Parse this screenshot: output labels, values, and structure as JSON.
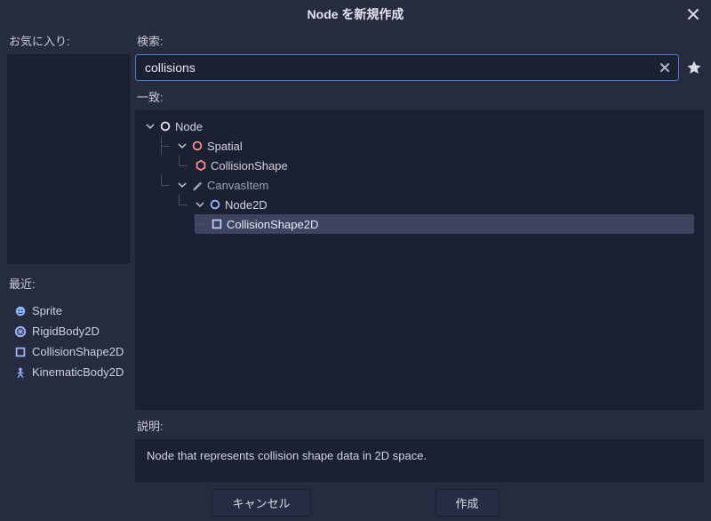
{
  "dialog": {
    "title": "Node を新規作成"
  },
  "left": {
    "favorites_label": "お気に入り:",
    "recent_label": "最近:",
    "recent": [
      {
        "label": "Sprite",
        "icon": "sprite"
      },
      {
        "label": "RigidBody2D",
        "icon": "rigid"
      },
      {
        "label": "CollisionShape2D",
        "icon": "collshape2d"
      },
      {
        "label": "KinematicBody2D",
        "icon": "kinematic"
      }
    ]
  },
  "right": {
    "search_label": "検索:",
    "search_value": "collisions",
    "matches_label": "一致:",
    "description_label": "説明:",
    "description_text": "Node that represents collision shape data in 2D space."
  },
  "tree": {
    "root": {
      "label": "Node",
      "icon": "node",
      "expanded": true
    },
    "spatial": {
      "label": "Spatial",
      "icon": "spatial",
      "expanded": true
    },
    "collisionshape": {
      "label": "CollisionShape",
      "icon": "collshape3d"
    },
    "canvasitem": {
      "label": "CanvasItem",
      "icon": "canvasitem",
      "expanded": true
    },
    "node2d": {
      "label": "Node2D",
      "icon": "node2d",
      "expanded": true
    },
    "collisionshape2d": {
      "label": "CollisionShape2D",
      "icon": "collshape2d",
      "selected": true
    }
  },
  "footer": {
    "cancel_label": "キャンセル",
    "create_label": "作成"
  }
}
